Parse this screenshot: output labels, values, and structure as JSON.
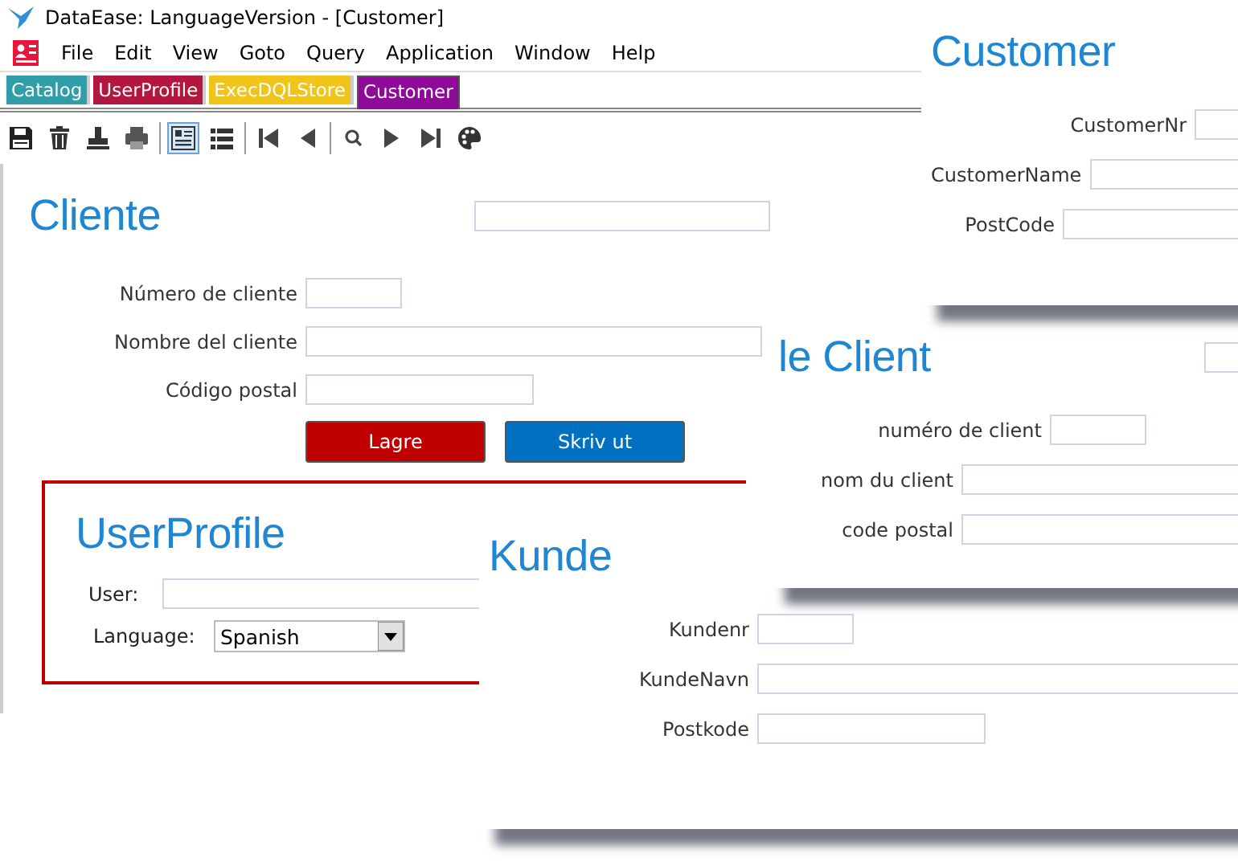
{
  "window": {
    "title": "DataEase: LanguageVersion - [Customer]"
  },
  "menu": [
    "File",
    "Edit",
    "View",
    "Goto",
    "Query",
    "Application",
    "Window",
    "Help"
  ],
  "tabs": [
    {
      "label": "Catalog",
      "color": "#2f9ea8",
      "selected": false
    },
    {
      "label": "UserProfile",
      "color": "#b3163f",
      "selected": false
    },
    {
      "label": "ExecDQLStore",
      "color": "#f0c419",
      "selected": false
    },
    {
      "label": "Customer",
      "color": "#8e0a98",
      "selected": true
    }
  ],
  "toolbar": [
    {
      "kind": "save",
      "selected": false
    },
    {
      "kind": "delete",
      "selected": false
    },
    {
      "kind": "stamp",
      "selected": false
    },
    {
      "kind": "print",
      "selected": false
    },
    {
      "kind": "form",
      "selected": true
    },
    {
      "kind": "list",
      "selected": false
    },
    {
      "kind": "first",
      "selected": false
    },
    {
      "kind": "prev",
      "selected": false
    },
    {
      "kind": "search",
      "selected": false
    },
    {
      "kind": "next",
      "selected": false
    },
    {
      "kind": "last",
      "selected": false
    },
    {
      "kind": "palette",
      "selected": false
    }
  ],
  "form": {
    "title": "Cliente",
    "header_field": true,
    "fields": [
      {
        "label": "Número de cliente",
        "kind": "short"
      },
      {
        "label": "Nombre del cliente",
        "kind": "long"
      },
      {
        "label": "Código postal",
        "kind": "medium"
      }
    ],
    "buttons": [
      {
        "label": "Lagre",
        "kind": "save"
      },
      {
        "label": "Skriv ut",
        "kind": "print"
      }
    ]
  },
  "user_profile": {
    "title": "UserProfile",
    "user_label": "User:",
    "language_label": "Language:",
    "language": "Spanish"
  },
  "windows": [
    {
      "title": "Kunde",
      "fields": [
        {
          "label": "Kundenr",
          "kind": "short"
        },
        {
          "label": "KundeNavn",
          "kind": "long"
        },
        {
          "label": "Postkode",
          "kind": "medium"
        }
      ]
    },
    {
      "title": "le Client",
      "header_field": true,
      "fields": [
        {
          "label": "numéro de client",
          "kind": "short"
        },
        {
          "label": "nom du client",
          "kind": "long"
        },
        {
          "label": "code postal",
          "kind": "long"
        }
      ]
    },
    {
      "title": "Customer",
      "fields": [
        {
          "label": "CustomerNr",
          "kind": "short"
        },
        {
          "label": "CustomerName",
          "kind": "long"
        },
        {
          "label": "PostCode",
          "kind": "medium"
        }
      ]
    }
  ]
}
